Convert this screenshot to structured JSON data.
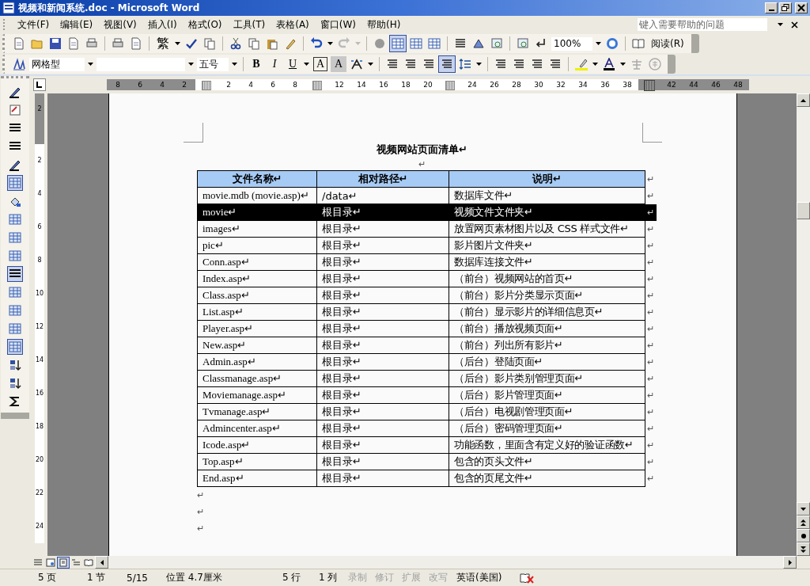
{
  "window": {
    "title": "视频和新闻系统.doc - Microsoft Word"
  },
  "menu": [
    {
      "label": "文件(F)"
    },
    {
      "label": "编辑(E)"
    },
    {
      "label": "视图(V)"
    },
    {
      "label": "插入(I)"
    },
    {
      "label": "格式(O)"
    },
    {
      "label": "工具(T)"
    },
    {
      "label": "表格(A)"
    },
    {
      "label": "窗口(W)"
    },
    {
      "label": "帮助(H)"
    }
  ],
  "help_search": {
    "placeholder": "键入需要帮助的问题"
  },
  "standard_toolbar": {
    "traditional": "繁",
    "zoom": "100%",
    "read": "阅读(R)"
  },
  "formatting_toolbar": {
    "style": "网格型",
    "size": "五号",
    "bold": "B",
    "italic": "I",
    "underline": "U",
    "border_char": "A",
    "shade_char": "A"
  },
  "ruler": [
    {
      "kind": "number",
      "label": "8",
      "margin": true
    },
    {
      "kind": "number",
      "label": "6",
      "margin": true
    },
    {
      "kind": "number",
      "label": "4",
      "margin": true
    },
    {
      "kind": "number",
      "label": "2",
      "margin": true
    },
    {
      "kind": "marker",
      "margin": false
    },
    {
      "kind": "number",
      "label": "2",
      "margin": false
    },
    {
      "kind": "number",
      "label": "4",
      "margin": false
    },
    {
      "kind": "number",
      "label": "6",
      "margin": false
    },
    {
      "kind": "number",
      "label": "8",
      "margin": false
    },
    {
      "kind": "marker",
      "margin": false
    },
    {
      "kind": "number",
      "label": "12",
      "margin": false
    },
    {
      "kind": "number",
      "label": "14",
      "margin": false
    },
    {
      "kind": "number",
      "label": "16",
      "margin": false
    },
    {
      "kind": "number",
      "label": "18",
      "margin": false
    },
    {
      "kind": "number",
      "label": "20",
      "margin": false
    },
    {
      "kind": "marker",
      "margin": false
    },
    {
      "kind": "number",
      "label": "24",
      "margin": false
    },
    {
      "kind": "number",
      "label": "26",
      "margin": false
    },
    {
      "kind": "number",
      "label": "28",
      "margin": false
    },
    {
      "kind": "number",
      "label": "30",
      "margin": false
    },
    {
      "kind": "number",
      "label": "32",
      "margin": false
    },
    {
      "kind": "number",
      "label": "34",
      "margin": false
    },
    {
      "kind": "number",
      "label": "36",
      "margin": false
    },
    {
      "kind": "number",
      "label": "38",
      "margin": false
    },
    {
      "kind": "marker",
      "margin": true
    },
    {
      "kind": "number",
      "label": "42",
      "margin": true
    },
    {
      "kind": "number",
      "label": "44",
      "margin": true
    },
    {
      "kind": "number",
      "label": "46",
      "margin": true
    },
    {
      "kind": "number",
      "label": "48",
      "margin": true
    }
  ],
  "vertical_ruler": [
    {
      "label": "2",
      "margin": true
    },
    {
      "label": "2",
      "margin": false
    },
    {
      "label": "4",
      "margin": false
    },
    {
      "label": "6",
      "margin": false
    },
    {
      "label": "8",
      "margin": false
    },
    {
      "label": "10",
      "margin": false
    },
    {
      "label": "12",
      "margin": false
    },
    {
      "label": "14",
      "margin": false
    },
    {
      "label": "16",
      "margin": false
    },
    {
      "label": "18",
      "margin": false
    },
    {
      "label": "20",
      "margin": false
    },
    {
      "label": "22",
      "margin": false
    },
    {
      "label": "24",
      "margin": false
    }
  ],
  "document": {
    "title": "视频网站页面清单↵",
    "after_title": "↵",
    "table": {
      "columns": [
        "文件名称↵",
        "相对路径↵",
        "说明↵"
      ],
      "header_end": "↵",
      "rows": [
        {
          "cells": [
            "movie.mdb (movie.asp)↵",
            "/data↵",
            "数据库文件↵"
          ],
          "end": "↵",
          "selected": false
        },
        {
          "cells": [
            "movie↵",
            "根目录↵",
            "视频文件文件夹↵"
          ],
          "end": "↵",
          "selected": true
        },
        {
          "cells": [
            "images↵",
            "根目录↵",
            "放置网页素材图片以及 CSS 样式文件↵"
          ],
          "end": "↵",
          "selected": false
        },
        {
          "cells": [
            "pic↵",
            "根目录↵",
            "影片图片文件夹↵"
          ],
          "end": "↵",
          "selected": false
        },
        {
          "cells": [
            "Conn.asp↵",
            "根目录↵",
            "数据库连接文件↵"
          ],
          "end": "↵",
          "selected": false
        },
        {
          "cells": [
            "Index.asp↵",
            "根目录↵",
            "（前台）视频网站的首页↵"
          ],
          "end": "↵",
          "selected": false
        },
        {
          "cells": [
            "Class.asp↵",
            "根目录↵",
            "（前台）影片分类显示页面↵"
          ],
          "end": "↵",
          "selected": false
        },
        {
          "cells": [
            "List.asp↵",
            "根目录↵",
            "（前台）显示影片的详细信息页↵"
          ],
          "end": "↵",
          "selected": false
        },
        {
          "cells": [
            "Player.asp↵",
            "根目录↵",
            "（前台）播放视频页面↵"
          ],
          "end": "↵",
          "selected": false
        },
        {
          "cells": [
            "New.asp↵",
            "根目录↵",
            "（前台）列出所有影片↵"
          ],
          "end": "↵",
          "selected": false
        },
        {
          "cells": [
            "Admin.asp↵",
            "根目录↵",
            "（后台）登陆页面↵"
          ],
          "end": "↵",
          "selected": false
        },
        {
          "cells": [
            "Classmanage.asp↵",
            "根目录↵",
            "（后台）影片类别管理页面↵"
          ],
          "end": "↵",
          "selected": false
        },
        {
          "cells": [
            "Moviemanage.asp↵",
            "根目录↵",
            "（后台）影片管理页面↵"
          ],
          "end": "↵",
          "selected": false
        },
        {
          "cells": [
            "Tvmanage.asp↵",
            "根目录↵",
            "（后台）电视剧管理页面↵"
          ],
          "end": "↵",
          "selected": false
        },
        {
          "cells": [
            "Admincenter.asp↵",
            "根目录↵",
            "（后台）密码管理页面↵"
          ],
          "end": "↵",
          "selected": false
        },
        {
          "cells": [
            "Icode.asp↵",
            "根目录↵",
            "功能函数，里面含有定义好的验证函数↵"
          ],
          "end": "↵",
          "selected": false
        },
        {
          "cells": [
            "Top.asp↵",
            "根目录↵",
            "包含的页头文件↵"
          ],
          "end": "↵",
          "selected": false
        },
        {
          "cells": [
            "End.asp↵",
            "根目录↵",
            "包含的页尾文件↵"
          ],
          "end": "↵",
          "selected": false
        }
      ]
    },
    "empty_paragraphs": [
      "↵",
      "↵",
      "↵"
    ]
  },
  "view_buttons": [
    {
      "kind": "normal",
      "selected": false
    },
    {
      "kind": "web",
      "selected": false
    },
    {
      "kind": "print",
      "selected": true
    },
    {
      "kind": "outline",
      "selected": false
    },
    {
      "kind": "reading",
      "selected": false
    }
  ],
  "status_bar": {
    "items": [
      "5 页",
      "1 节",
      "5/15",
      "位置 4.7厘米",
      "5 行",
      "1 列"
    ],
    "modes": [
      {
        "label": "录制",
        "active": false
      },
      {
        "label": "修订",
        "active": false
      },
      {
        "label": "扩展",
        "active": false
      },
      {
        "label": "改写",
        "active": false
      }
    ],
    "language": "英语(美国)"
  }
}
